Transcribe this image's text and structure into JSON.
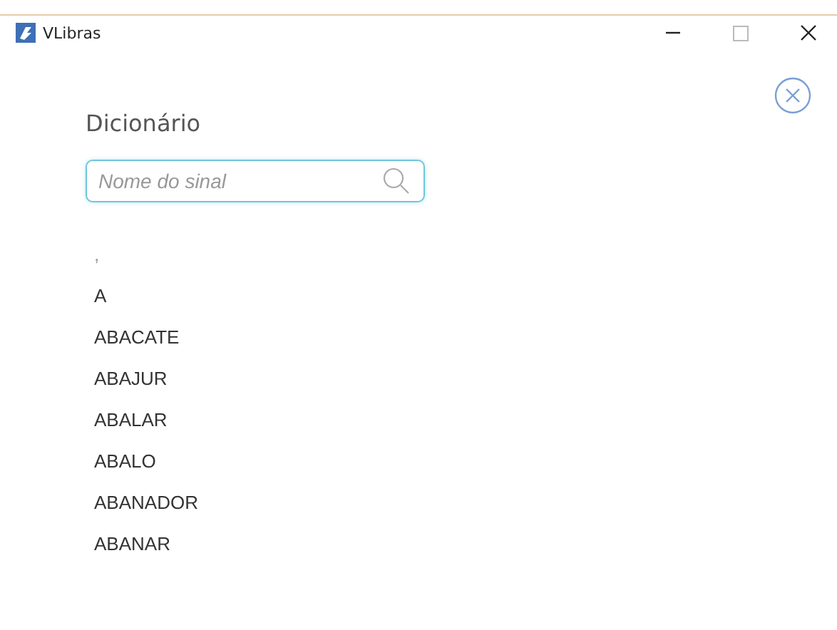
{
  "window": {
    "title": "VLibras"
  },
  "heading": "Dicionário",
  "search": {
    "placeholder": "Nome do sinal"
  },
  "words": [
    ",",
    "A",
    "ABACATE",
    "ABAJUR",
    "ABALAR",
    "ABALO",
    "ABANADOR",
    "ABANAR"
  ]
}
